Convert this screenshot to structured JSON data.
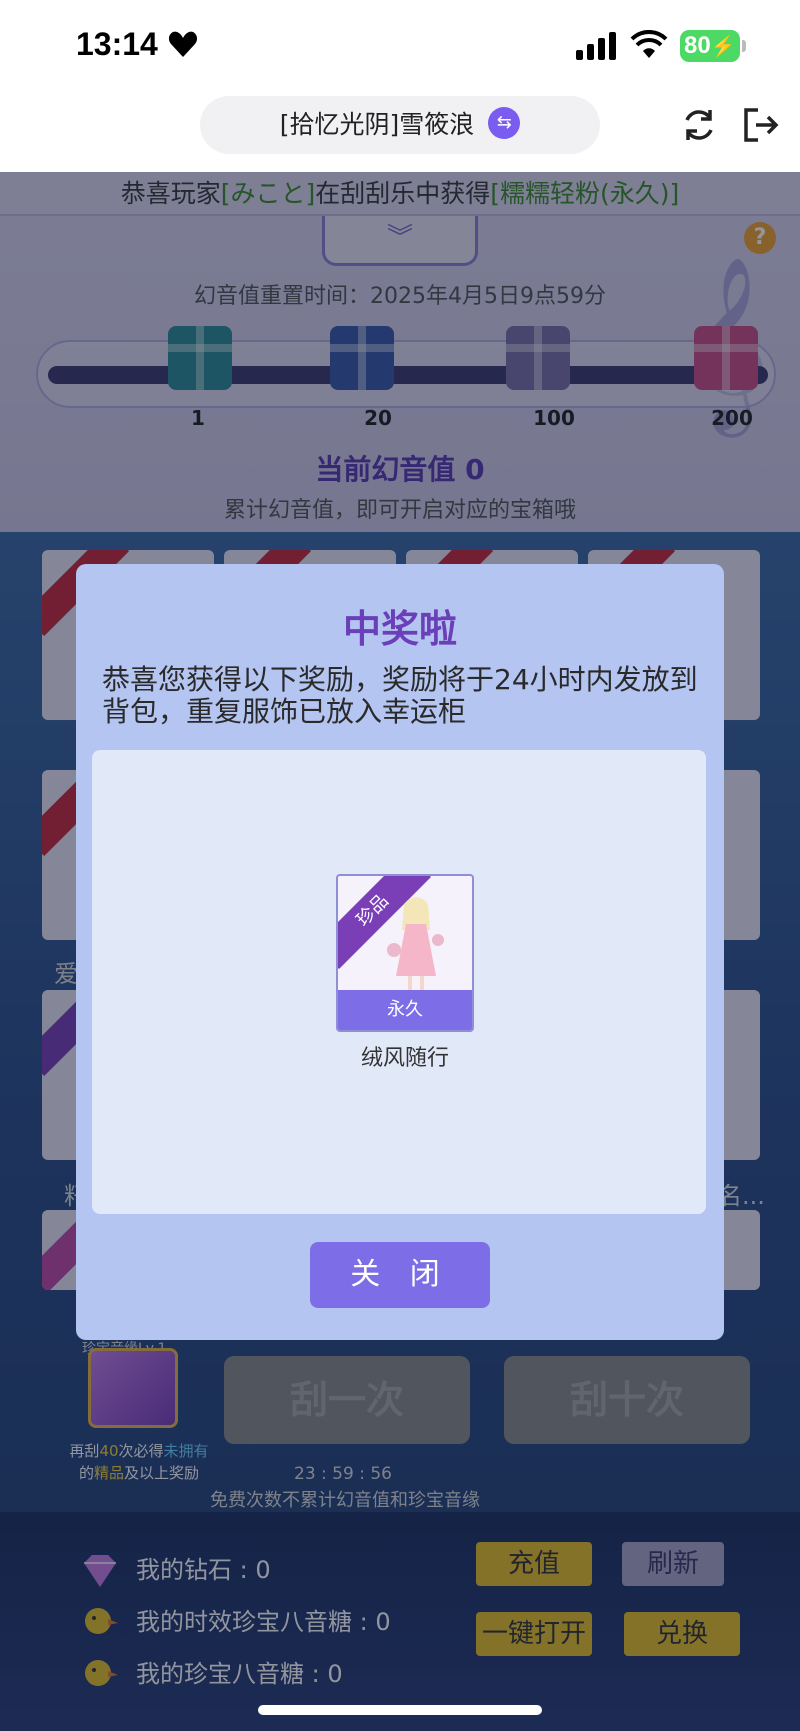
{
  "status": {
    "time": "13:14",
    "battery": "80"
  },
  "browser": {
    "title": "[拾忆光阴]雪筱浪",
    "switch_icon": "swap-icon",
    "refresh_icon": "refresh-icon",
    "exit_icon": "exit-icon"
  },
  "game": {
    "announce_prefix": "恭喜玩家",
    "announce_player": "[みこと]",
    "announce_mid": "在刮刮乐中获得",
    "announce_item": "[糯糯轻粉(永久)]",
    "help_label": "?",
    "reset_time": "幻音值重置时间：2025年4月5日9点59分",
    "milestones": [
      "1",
      "20",
      "100",
      "200"
    ],
    "current_value_label": "当前幻音值 0",
    "current_value_hint": "累计幻音值，即可开启对应的宝箱哦",
    "side_labels": [
      "爱",
      "籽",
      "名..."
    ],
    "level_title": "珍宝音缘Lv.1",
    "level_hint_1": "再刮",
    "level_hint_count": "40",
    "level_hint_2": "次必得",
    "level_hint_unowned": "未拥有",
    "level_hint_3": "的",
    "level_hint_quality": "精品",
    "level_hint_4": "及以上奖励",
    "scratch_once": "刮一次",
    "scratch_ten": "刮十次",
    "countdown": "23 : 59 : 56",
    "free_hint": "免费次数不累计幻音值和珍宝音缘",
    "diamond_label": "我的钻石 : 0",
    "timed_candy_label": "我的时效珍宝八音糖 : 0",
    "candy_label": "我的珍宝八音糖 : 0",
    "recharge": "充值",
    "refresh": "刷新",
    "open_all": "一键打开",
    "exchange": "兑换"
  },
  "modal": {
    "title": "中奖啦",
    "description": "恭喜您获得以下奖励，奖励将于24小时内发放到背包，重复服饰已放入幸运柜",
    "reward": {
      "quality": "珍品",
      "duration": "永久",
      "name": "绒风随行"
    },
    "close_label": "关 闭"
  },
  "colors": {
    "accent": "#7d6ee8",
    "title_purple": "#6a3fb8",
    "quality_ribbon": "#7a3eb6",
    "gold": "#e9c02a"
  }
}
